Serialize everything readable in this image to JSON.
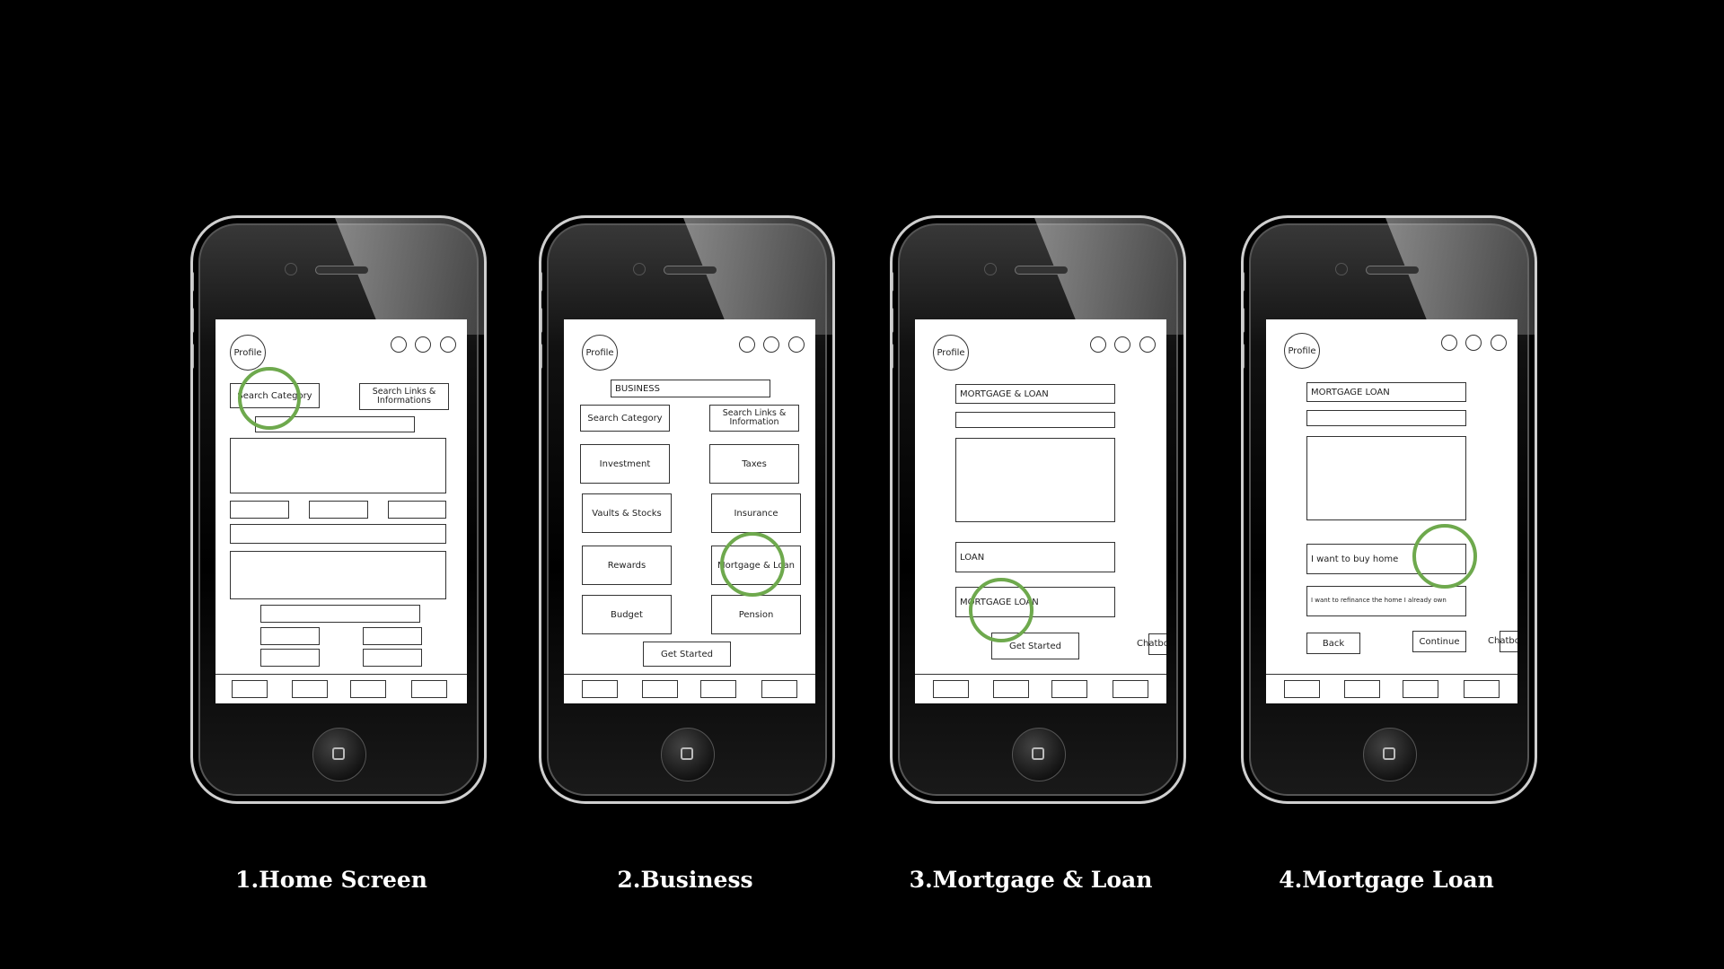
{
  "screens": [
    {
      "caption": "1.Home Screen",
      "profile_label": "Profile",
      "search_category_label": "Search Category",
      "search_links_label": "Search Links & Informations"
    },
    {
      "caption": "2.Business",
      "profile_label": "Profile",
      "business_field": "BUSINESS",
      "search_category_label": "Search Category",
      "search_links_label": "Search Links & Information",
      "categories": [
        "Investment",
        "Taxes",
        "Vaults & Stocks",
        "Insurance",
        "Rewards",
        "Mortgage & Loan",
        "Budget",
        "Pension"
      ],
      "get_started_label": "Get Started"
    },
    {
      "caption": "3.Mortgage & Loan",
      "profile_label": "Profile",
      "title_field": "MORTGAGE & LOAN",
      "loan_field": "LOAN",
      "mortgage_loan_field": "MORTGAGE LOAN",
      "get_started_label": "Get Started",
      "chatbot_label": "Chatbot"
    },
    {
      "caption": "4.Mortgage  Loan",
      "profile_label": "Profile",
      "title_field": "MORTGAGE LOAN",
      "option_buy": "I want to buy home",
      "option_refinance": "I want to refinance the home I already own",
      "back_label": "Back",
      "continue_label": "Continue",
      "chatbot_label": "Chatbot"
    }
  ],
  "colors": {
    "background": "#000000",
    "highlight": "#6ea94d",
    "screen": "#ffffff"
  }
}
